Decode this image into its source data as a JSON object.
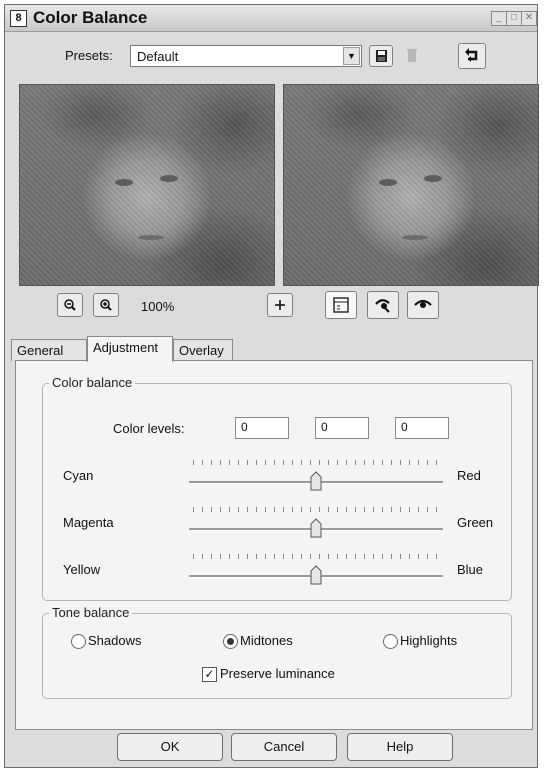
{
  "window": {
    "title": "Color Balance",
    "app_icon_text": "8"
  },
  "presets": {
    "label": "Presets:",
    "value": "Default"
  },
  "preview": {
    "zoom": "100%"
  },
  "tabs": [
    {
      "label": "General"
    },
    {
      "label": "Adjustment"
    },
    {
      "label": "Overlay"
    }
  ],
  "color_balance": {
    "title": "Color balance",
    "levels_label": "Color levels:",
    "levels": [
      "0",
      "0",
      "0"
    ],
    "sliders": [
      {
        "left": "Cyan",
        "right": "Red",
        "value": 0
      },
      {
        "left": "Magenta",
        "right": "Green",
        "value": 0
      },
      {
        "left": "Yellow",
        "right": "Blue",
        "value": 0
      }
    ]
  },
  "tone_balance": {
    "title": "Tone balance",
    "options": [
      {
        "label": "Shadows",
        "selected": false
      },
      {
        "label": "Midtones",
        "selected": true
      },
      {
        "label": "Highlights",
        "selected": false
      }
    ],
    "preserve_luminance": {
      "label": "Preserve luminance",
      "checked": true
    }
  },
  "footer": {
    "ok": "OK",
    "cancel": "Cancel",
    "help": "Help"
  },
  "icons": {
    "save": "floppy-disk-icon",
    "delete": "trash-icon",
    "reset": "reset-arrow-icon",
    "zoom_out": "zoom-out-icon",
    "zoom_in": "zoom-in-icon",
    "pan": "pan-crosshair-icon",
    "proof": "proof-icon",
    "auto_proof": "auto-proof-icon",
    "eye": "preview-eye-icon"
  }
}
